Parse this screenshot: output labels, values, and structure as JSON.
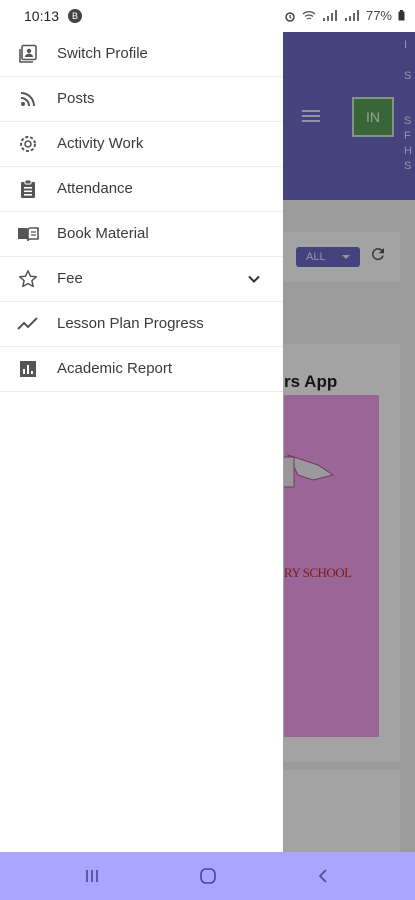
{
  "status_bar": {
    "time": "10:13",
    "notif_badge": "B",
    "battery": "77%"
  },
  "drawer": {
    "items": [
      {
        "label": "Switch Profile",
        "icon": "switch-profile-icon"
      },
      {
        "label": "Posts",
        "icon": "rss-icon"
      },
      {
        "label": "Activity Work",
        "icon": "activity-icon"
      },
      {
        "label": "Attendance",
        "icon": "clipboard-icon"
      },
      {
        "label": "Book Material",
        "icon": "book-icon"
      },
      {
        "label": "Fee",
        "icon": "star-icon",
        "expandable": true
      },
      {
        "label": "Lesson Plan Progress",
        "icon": "trend-line-icon"
      },
      {
        "label": "Academic Report",
        "icon": "bar-chart-icon"
      }
    ]
  },
  "background_app": {
    "avatar_initials": "IN",
    "filter_value": "ALL",
    "post_title": "rs App",
    "banner_text": "RY SCHOOL",
    "header_text_lines": [
      "I",
      "S",
      "",
      "S",
      "F",
      "H",
      "S"
    ]
  },
  "colors": {
    "header": "#6c69c4",
    "navbar": "#a8a6ff",
    "banner": "#f0a0ec",
    "avatar": "#5aa05a"
  },
  "nav_buttons": [
    "recents-icon",
    "home-icon",
    "back-icon"
  ]
}
